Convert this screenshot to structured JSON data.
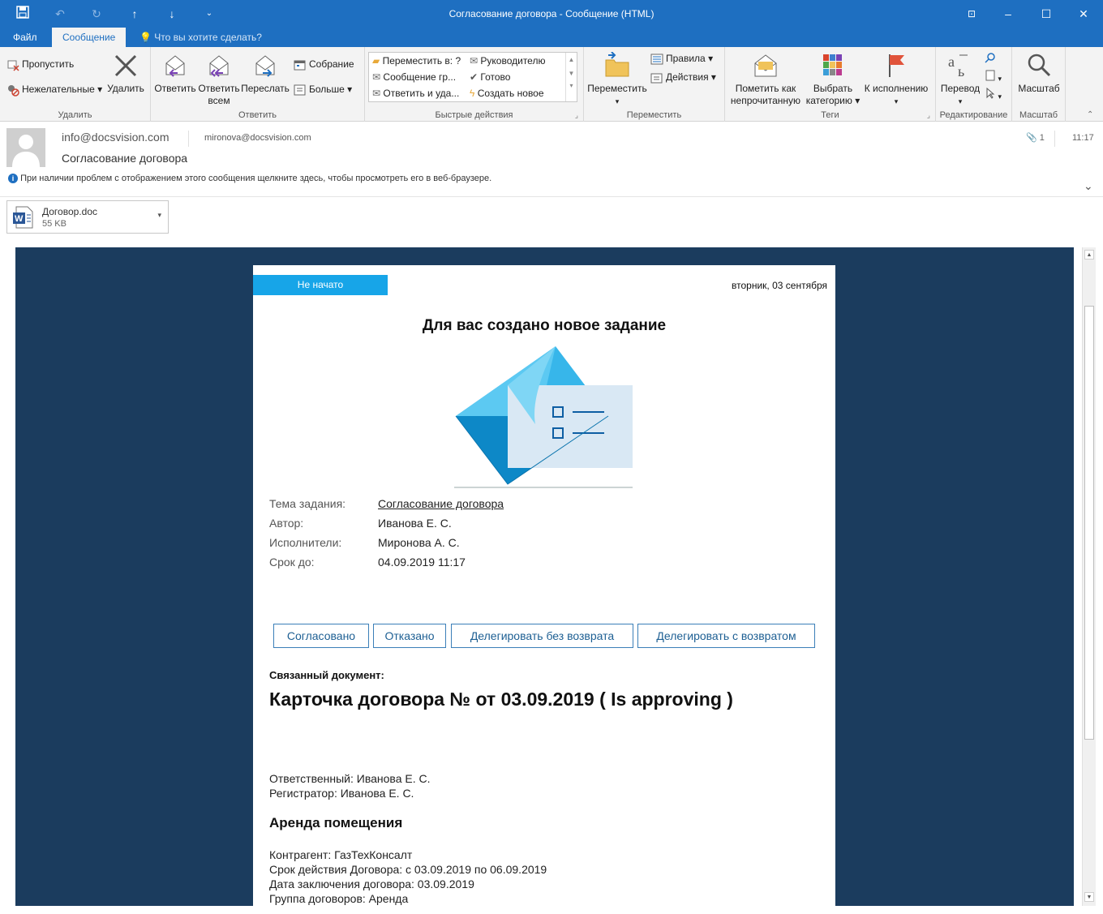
{
  "window": {
    "title": "Согласование договора - Сообщение (HTML)"
  },
  "ribbon_tabs": {
    "file": "Файл",
    "message": "Сообщение",
    "tell_me": "Что вы хотите сделать?"
  },
  "ribbon": {
    "delete_group": {
      "ignore": "Пропустить",
      "junk": "Нежелательные",
      "delete": "Удалить",
      "label": "Удалить"
    },
    "respond_group": {
      "reply": "Ответить",
      "reply_all_1": "Ответить",
      "reply_all_2": "всем",
      "forward": "Переслать",
      "meeting": "Собрание",
      "more": "Больше",
      "label": "Ответить"
    },
    "quick_steps": {
      "items": [
        "Переместить в: ?",
        "Сообщение гр...",
        "Ответить и уда...",
        "Руководителю",
        "Готово",
        "Создать новое"
      ],
      "label": "Быстрые действия"
    },
    "move_group": {
      "move": "Переместить",
      "rules": "Правила",
      "actions": "Действия",
      "label": "Переместить"
    },
    "tags_group": {
      "mark_unread_1": "Пометить как",
      "mark_unread_2": "непрочитанную",
      "categorize_1": "Выбрать",
      "categorize_2": "категорию",
      "followup": "К исполнению",
      "label": "Теги"
    },
    "editing_group": {
      "translate": "Перевод",
      "label": "Редактирование"
    },
    "zoom_group": {
      "zoom": "Масштаб",
      "label": "Масштаб"
    }
  },
  "header": {
    "from": "info@docsvision.com",
    "to": "mironova@docsvision.com",
    "subject": "Согласование договора",
    "info_bar": "При наличии проблем с отображением этого сообщения щелкните здесь, чтобы просмотреть его в веб-браузере.",
    "attachment_count": "1",
    "time": "11:17"
  },
  "attachment": {
    "name": "Договор.doc",
    "size": "55 KB"
  },
  "email": {
    "status": "Не начато",
    "date": "вторник, 03 сентября",
    "headline": "Для вас создано новое задание",
    "fields": [
      {
        "key": "Тема задания:",
        "value": "Согласование договора"
      },
      {
        "key": "Автор:",
        "value": "Иванова Е. С."
      },
      {
        "key": "Исполнители:",
        "value": "Миронова А. С."
      },
      {
        "key": "Срок до:",
        "value": "04.09.2019 11:17"
      }
    ],
    "buttons": [
      "Согласовано",
      "Отказано",
      "Делегировать без возврата",
      "Делегировать с возвратом"
    ],
    "related_label": "Связанный документ:",
    "document_title": "Карточка договора № от 03.09.2019 ( Is approving )",
    "responsible": "Ответственный: Иванова Е. С.",
    "registrar": "Регистратор: Иванова Е. С.",
    "section_title": "Аренда помещения",
    "contractor": "Контрагент: ГазТехКонсалт",
    "term": "Срок действия Договора: с 03.09.2019 по 06.09.2019",
    "conclusion_date": "Дата заключения договора: 03.09.2019",
    "contract_group": "Группа договоров: Аренда"
  },
  "colors": {
    "title_bar": "#1e6fc1",
    "body_bg": "#1b3c5e",
    "status_badge": "#17a5e8",
    "button_border": "#3b7fb8"
  }
}
